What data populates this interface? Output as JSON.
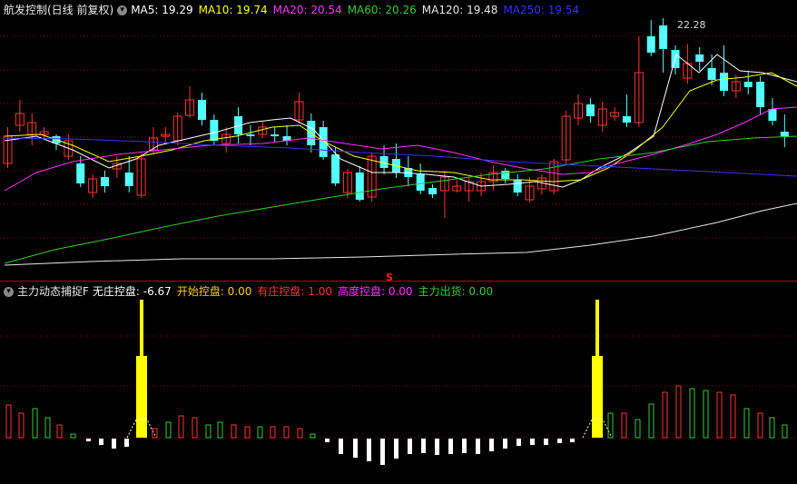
{
  "main_panel": {
    "title": "航发控制(日线 前复权)",
    "ma_items": [
      {
        "label": "MA5: 19.29",
        "color": "#ffffff"
      },
      {
        "label": "MA10: 19.74",
        "color": "#ffff00"
      },
      {
        "label": "MA20: 20.54",
        "color": "#ff33ff"
      },
      {
        "label": "MA60: 20.26",
        "color": "#33cc33"
      },
      {
        "label": "MA120: 19.48",
        "color": "#e8e8e8"
      },
      {
        "label": "MA250: 19.54",
        "color": "#3333ff"
      }
    ],
    "high_marker": "22.28",
    "signal_marker": "S"
  },
  "indicator_panel": {
    "title": "主力动态捕捉F",
    "items": [
      {
        "label": "无庄控盘: -6.67",
        "color": "#ffffff"
      },
      {
        "label": "开始控盘: 0.00",
        "color": "#ffcc00"
      },
      {
        "label": "有庄控盘: 1.00",
        "color": "#ff3333"
      },
      {
        "label": "高度控盘: 0.00",
        "color": "#ff33ff"
      },
      {
        "label": "主力出货: 0.00",
        "color": "#33cc33"
      }
    ]
  },
  "colors": {
    "up": "#ff3333",
    "down": "#54ffff",
    "grid": "#990000",
    "background": "#000000"
  }
}
